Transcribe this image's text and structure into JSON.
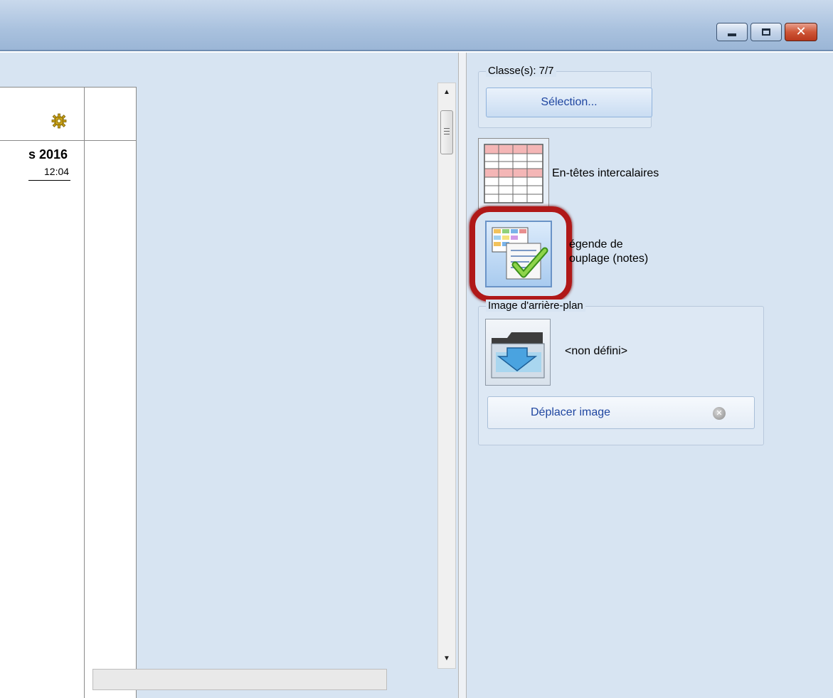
{
  "window": {
    "controls": {
      "minimize_icon": "minimize-icon",
      "maximize_icon": "maximize-icon",
      "close_icon": "close-icon"
    }
  },
  "grid": {
    "year_text": "s 2016",
    "time_text": "12:04",
    "gear_icon": "gear-icon"
  },
  "right_panel": {
    "classes_legend": "Classe(s): 7/7",
    "selection_button": "Sélection...",
    "entetes_label": "En-têtes intercalaires",
    "legende_label": "égende de",
    "legende_label_2": "ouplage (notes)",
    "background_legend": "Image d'arrière-plan",
    "non_defini": "<non défini>",
    "deplacer_button": "Déplacer image",
    "remove_icon": "clear-icon"
  },
  "colors": {
    "panel_bg": "#d7e4f2",
    "highlight_ring": "#b01818",
    "link_text": "#1f46a0"
  }
}
